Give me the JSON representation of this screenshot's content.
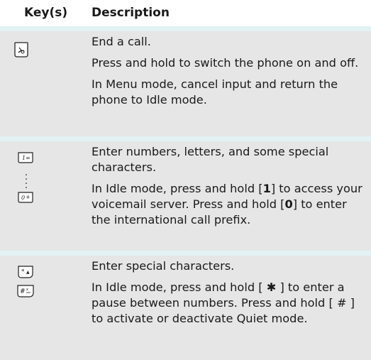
{
  "header": {
    "col_keys": "Key(s)",
    "col_description": "Description"
  },
  "rows": [
    {
      "keys": [
        "end-key"
      ],
      "lines": [
        "End a call.",
        "Press and hold to switch the phone on and off.",
        "In Menu mode, cancel input and return the phone to Idle mode."
      ]
    },
    {
      "keys": [
        "one-key",
        "zero-key"
      ],
      "lines": [
        "Enter numbers, letters, and some special characters.",
        "In Idle mode, press and hold [1] to access your voicemail server. Press and hold [0] to enter the international call prefix."
      ],
      "p2": {
        "a": "In Idle mode, press and hold [",
        "k1": "1",
        "b": "] to access your voicemail server. Press and hold [",
        "k2": "0",
        "c": "] to enter the international call prefix."
      }
    },
    {
      "keys": [
        "star-key",
        "hash-key"
      ],
      "lines": [
        "Enter special characters.",
        "In Idle mode, press and hold [ ✱ ] to enter a pause between numbers. Press and hold [ # ] to activate or deactivate Quiet mode."
      ],
      "p2": {
        "a": "In Idle mode, press and hold [ ",
        "k1": "✱",
        "b": " ] to enter a pause between numbers. Press and hold [ ",
        "k2": "#",
        "c": " ] to activate or deactivate Quiet mode."
      }
    }
  ]
}
